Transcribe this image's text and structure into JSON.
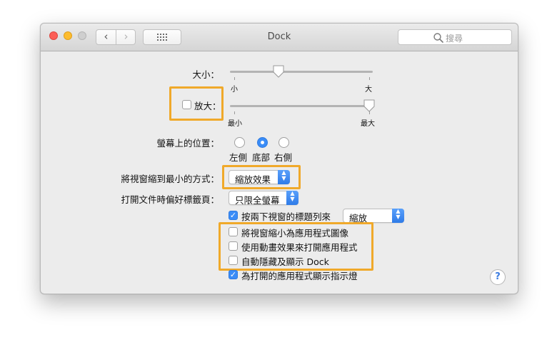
{
  "window": {
    "title": "Dock"
  },
  "toolbar": {
    "back_glyph": "‹",
    "forward_glyph": "›",
    "search_placeholder": "搜尋"
  },
  "size": {
    "label": "大小：",
    "min_label": "小",
    "max_label": "大",
    "value_fraction": 0.33
  },
  "magnification": {
    "checkbox_checked": false,
    "label": "放大：",
    "min_label": "最小",
    "max_label": "最大",
    "value_fraction": 1.0
  },
  "position": {
    "label": "螢幕上的位置：",
    "options": [
      "左側",
      "底部",
      "右側"
    ],
    "selected": "底部"
  },
  "minimize": {
    "label": "將視窗縮到最小的方式：",
    "value": "縮放效果"
  },
  "prefer_tabs": {
    "label": "打開文件時偏好標籤頁：",
    "value": "只限全螢幕"
  },
  "double_click": {
    "label": "按兩下視窗的標題列來",
    "checked": true,
    "value": "縮放"
  },
  "checkboxes": [
    {
      "label": "將視窗縮小為應用程式圖像",
      "checked": false
    },
    {
      "label": "使用動畫效果來打開應用程式",
      "checked": false
    },
    {
      "label": "自動隱藏及顯示 Dock",
      "checked": false
    },
    {
      "label": "為打開的應用程式顯示指示燈",
      "checked": true
    }
  ],
  "help": {
    "glyph": "?"
  },
  "colors": {
    "accent": "#3a8cf7",
    "highlight": "#f0a92a"
  }
}
